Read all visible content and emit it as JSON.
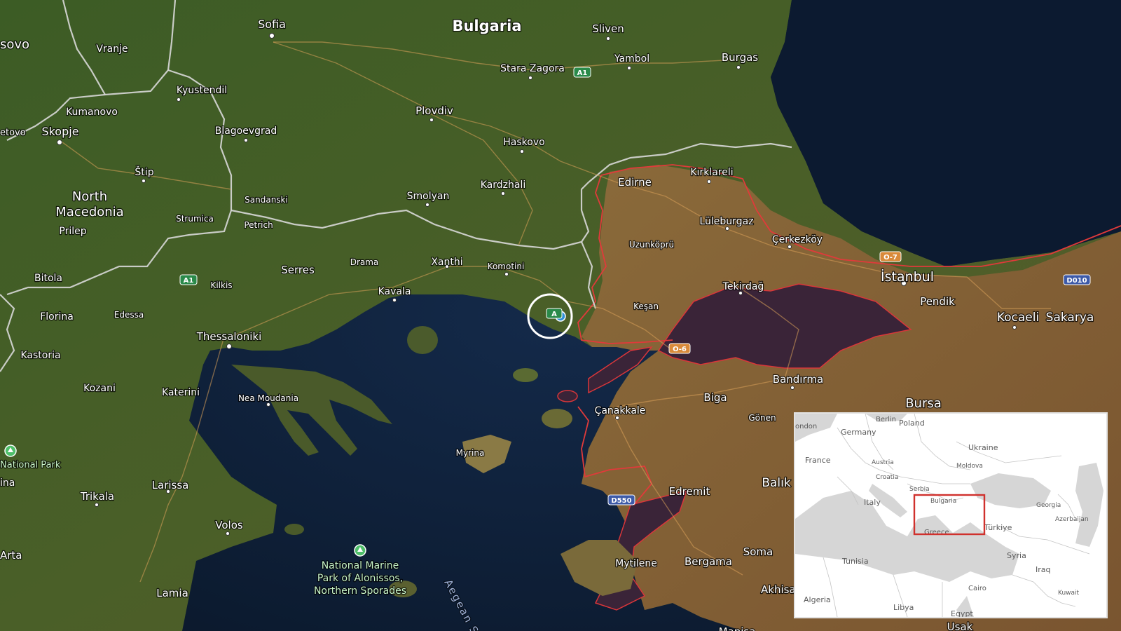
{
  "map": {
    "countries": {
      "bulgaria": "Bulgaria",
      "north_macedonia_line1": "North",
      "north_macedonia_line2": "Macedonia",
      "kosovo_partial": "sovo"
    },
    "cities": {
      "sofia": "Sofia",
      "sliven": "Sliven",
      "vranje": "Vranje",
      "yambol": "Yambol",
      "burgas": "Burgas",
      "stara_zagora": "Stara Zagora",
      "kyustendil": "Kyustendil",
      "kumanovo": "Kumanovo",
      "plovdiv": "Plovdiv",
      "skopje": "Skopje",
      "tetovo_partial": "etovo",
      "blagoevgrad": "Blagoevgrad",
      "haskovo": "Haskovo",
      "edirne": "Edirne",
      "kirklareli": "Kırklareli",
      "stip": "Štip",
      "kardzhali": "Kardzhali",
      "smolyan": "Smolyan",
      "sandanski": "Sandanski",
      "strumica": "Strumica",
      "luleburgaz": "Lüleburgaz",
      "prilep": "Prilep",
      "petrich": "Petrich",
      "cerkezkoy": "Çerkezköy",
      "uzunkopru": "Uzunköprü",
      "drama": "Drama",
      "xanthi": "Xanthi",
      "komotini": "Komotini",
      "serres": "Serres",
      "bitola": "Bitola",
      "istanbul": "İstanbul",
      "kilkis": "Kilkis",
      "tekirdag": "Tekirdağ",
      "kavala": "Kavala",
      "pendik": "Pendik",
      "kocaeli": "Kocaeli",
      "sakarya": "Sakarya",
      "florina": "Florina",
      "edessa": "Edessa",
      "kesan": "Keşan",
      "thessaloniki": "Thessaloniki",
      "kastoria": "Kastoria",
      "bandirma": "Bandırma",
      "kozani": "Kozani",
      "katerini": "Katerini",
      "nea_moudania": "Nea Moudania",
      "biga": "Biga",
      "bursa": "Bursa",
      "canakkale": "Çanakkale",
      "gonen": "Gönen",
      "myrina": "Myrina",
      "larissa": "Larissa",
      "edremit": "Edremit",
      "balik_partial": "Balık",
      "trikala": "Trikala",
      "volos": "Volos",
      "soma": "Soma",
      "mytilene": "Mytilene",
      "bergama": "Bergama",
      "arta": "Arta",
      "akhisar_partial": "Akhisa",
      "lamia": "Lamia",
      "usak_partial": "Usak",
      "manisa_partial": "Manisa",
      "ina_partial": "ina"
    },
    "parks": {
      "national_park_partial": "National Park",
      "alonissos_line1": "National Marine",
      "alonissos_line2": "Park of Alonissos,",
      "alonissos_line3": "Northern Sporades"
    },
    "seas": {
      "aegean_partial": "Aegean S"
    },
    "road_shields": {
      "a1_bulgaria": "A1",
      "a1_greece": "A1",
      "a_small": "A",
      "o7": "O-7",
      "o6": "O-6",
      "d010": "D010",
      "d550": "D550"
    }
  },
  "inset": {
    "labels": {
      "london": "ondon",
      "berlin": "Berlin",
      "poland": "Poland",
      "germany": "Germany",
      "ukraine": "Ukraine",
      "france": "France",
      "austria": "Austria",
      "moldova": "Moldova",
      "croatia": "Croatia",
      "serbia": "Serbia",
      "bulgaria": "Bulgaria",
      "georgia": "Georgia",
      "italy": "Italy",
      "azerbaijan": "Azerbaijan",
      "greece": "Greece",
      "turkiye": "Türkiye",
      "syria": "Syria",
      "tunisia": "Tunisia",
      "iraq": "Iraq",
      "cairo": "Cairo",
      "kuwait": "Kuwait",
      "algeria": "Algeria",
      "libya": "Libya",
      "egypt": "Egypt"
    },
    "highlight_color": "#d0312d"
  },
  "colors": {
    "sea": "#0d1c33",
    "land": "#3e5a26",
    "highlight_border": "#e03a3a",
    "location_dot": "#2f8fd6"
  }
}
